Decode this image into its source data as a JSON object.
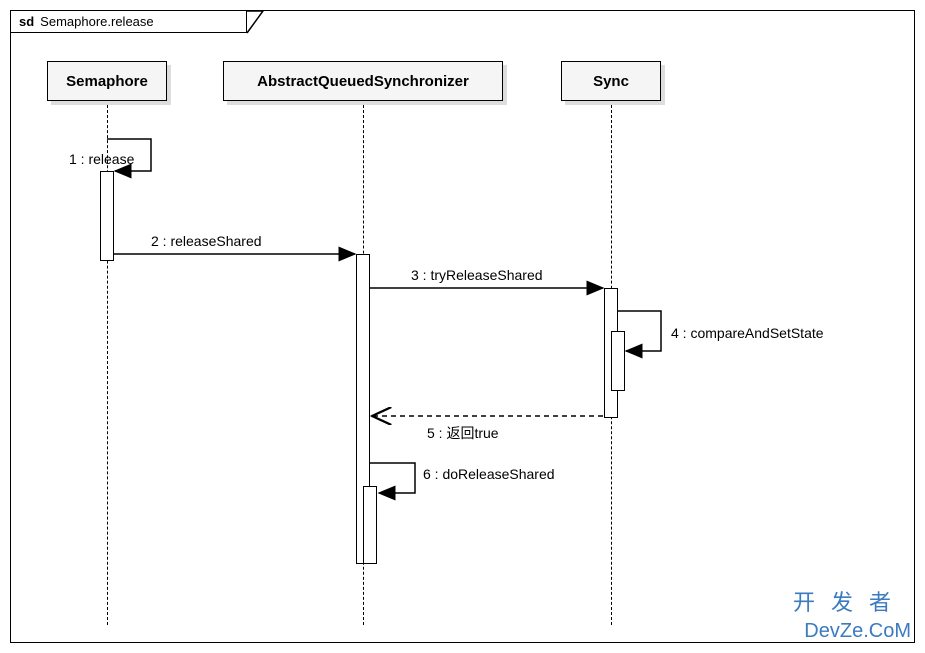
{
  "title_prefix": "sd",
  "title": "Semaphore.release",
  "participants": {
    "p1": "Semaphore",
    "p2": "AbstractQueuedSynchronizer",
    "p3": "Sync"
  },
  "messages": {
    "m1": "1 : release",
    "m2": "2 : releaseShared",
    "m3": "3 : tryReleaseShared",
    "m4": "4 : compareAndSetState",
    "m5": "5 : 返回true",
    "m6": "6 : doReleaseShared"
  },
  "watermark": {
    "line1": "开发者",
    "line2": "DevZe.CoM"
  }
}
